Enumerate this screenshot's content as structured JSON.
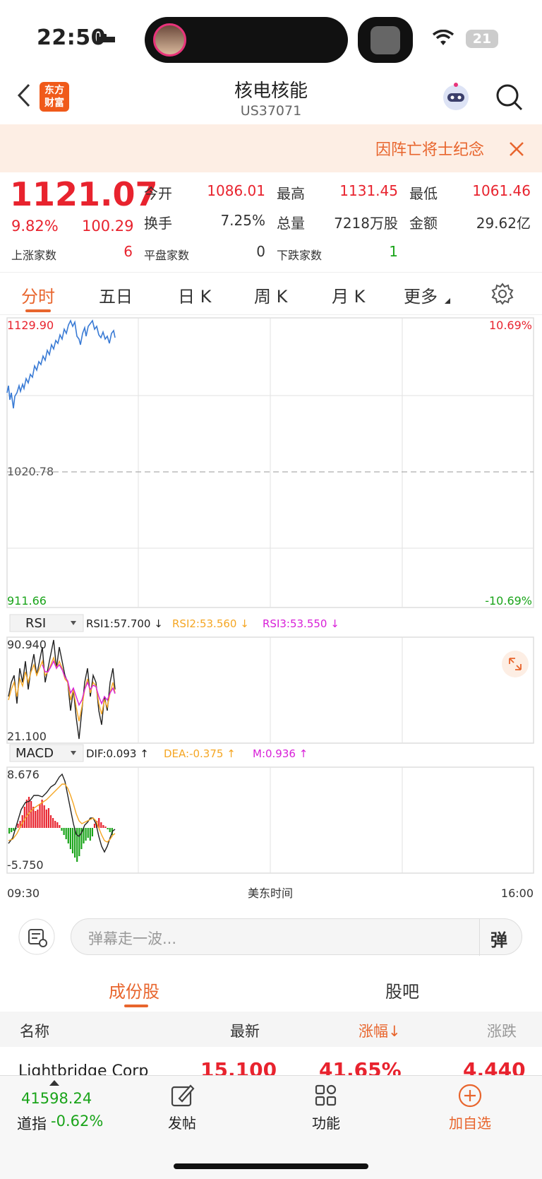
{
  "status_bar": {
    "time": "22:50",
    "battery": "21"
  },
  "nav": {
    "title": "核电核能",
    "code": "US37071",
    "logo_line1": "东方",
    "logo_line2": "财富"
  },
  "banner": {
    "text": "因阵亡将士纪念"
  },
  "quote": {
    "price": "1121.07",
    "change_pct": "9.82%",
    "change": "100.29",
    "stats": [
      {
        "label": "今开",
        "value": "1086.01"
      },
      {
        "label": "最高",
        "value": "1131.45"
      },
      {
        "label": "最低",
        "value": "1061.46"
      },
      {
        "label": "换手",
        "value": "7.25%"
      },
      {
        "label": "总量",
        "value": "7218万股"
      },
      {
        "label": "金额",
        "value": "29.62亿"
      }
    ],
    "breadth": [
      {
        "label": "上涨家数",
        "value": "6"
      },
      {
        "label": "平盘家数",
        "value": "0"
      },
      {
        "label": "下跌家数",
        "value": "1"
      }
    ]
  },
  "chart_tabs": [
    "分时",
    "五日",
    "日 K",
    "周 K",
    "月 K",
    "更多"
  ],
  "main_chart": {
    "y_top": "1129.90",
    "y_mid": "1020.78",
    "y_bottom": "911.66",
    "pct_top": "10.69%",
    "pct_bottom": "-10.69%",
    "x_start": "09:30",
    "x_mid": "美东时间",
    "x_end": "16:00"
  },
  "rsi": {
    "selector": "RSI",
    "rsi1": "RSI1:57.700 ↓",
    "rsi2": "RSI2:53.560 ↓",
    "rsi3": "RSI3:53.550 ↓",
    "y_top": "90.940",
    "y_bottom": "21.100"
  },
  "macd": {
    "selector": "MACD",
    "dif": "DIF:0.093 ↑",
    "dea": "DEA:-0.375 ↑",
    "m": "M:0.936 ↑",
    "y_top": "8.676",
    "y_bottom": "-5.750"
  },
  "chat": {
    "placeholder": "弹幕走一波...",
    "danmu_label": "弹"
  },
  "section_tabs": {
    "constituents": "成份股",
    "forum": "股吧"
  },
  "list": {
    "headers": {
      "name": "名称",
      "latest": "最新",
      "change_pct": "涨幅↓",
      "change": "涨跌"
    },
    "rows": [
      {
        "name": "Lightbridge Corp",
        "latest": "15.100",
        "change_pct": "41.65%",
        "change": "4.440"
      }
    ]
  },
  "bottom_bar": {
    "index_value": "41598.24",
    "index_name": "道指",
    "index_change": "-0.62%",
    "post": "发帖",
    "functions": "功能",
    "add_watch": "加自选"
  },
  "colors": {
    "up": "#e8232e",
    "down": "#1aa41a",
    "accent": "#e8652d",
    "price_line": "#3a7bd5",
    "dea": "#f5a623",
    "m": "#d81fd8"
  }
}
